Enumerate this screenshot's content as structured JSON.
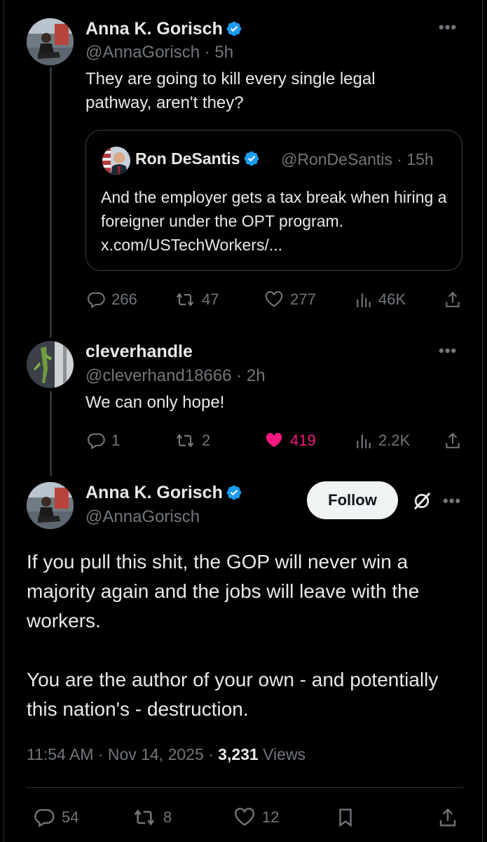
{
  "colors": {
    "background": "#000000",
    "primary_text": "#e7e9ea",
    "secondary_text": "#71767b",
    "verified_blue": "#1d9bf0",
    "like_pink": "#f91880",
    "follow_bg": "#eff3f4"
  },
  "post1": {
    "author_name": "Anna K. Gorisch",
    "handle_time": "@AnnaGorisch · 5h",
    "text": "They are going to kill every single legal pathway, aren't they?",
    "quote": {
      "author_name": "Ron DeSantis",
      "handle_time": "@RonDeSantis · 15h",
      "text": "And the employer gets a tax break when hiring a foreigner under the OPT program. x.com/USTechWorkers/..."
    },
    "replies": "266",
    "reposts": "47",
    "likes": "277",
    "views": "46K"
  },
  "post2": {
    "author_name": "cleverhandle",
    "handle_time": "@cleverhand18666 · 2h",
    "text": "We can only hope!",
    "replies": "1",
    "reposts": "2",
    "likes": "419",
    "liked": true,
    "views": "2.2K"
  },
  "main_post": {
    "author_name": "Anna K. Gorisch",
    "handle": "@AnnaGorisch",
    "follow_label": "Follow",
    "text": "If you pull this shit, the GOP will never win a majority again and the jobs will leave with the workers.\n\nYou are the author of your own - and potentially this nation's - destruction.",
    "time_date": "11:54 AM · Nov 14, 2025 · ",
    "views_count": "3,231",
    "views_label": " Views",
    "replies": "54",
    "reposts": "8",
    "likes": "12"
  }
}
